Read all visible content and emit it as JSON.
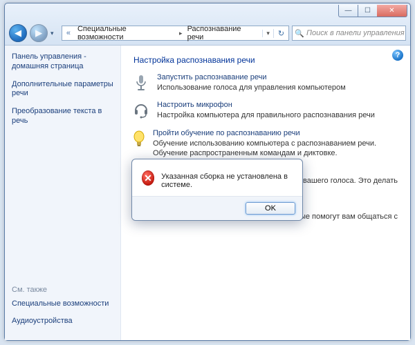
{
  "titlebar": {
    "min": "—",
    "max": "☐",
    "close": "✕"
  },
  "nav": {
    "back": "◀",
    "forward": "▶",
    "drop": "▾",
    "addr_chev": "«",
    "seg1": "Специальные возможности",
    "seg2": "Распознавание речи",
    "sep": "▸",
    "addr_drop": "▾",
    "refresh": "↻"
  },
  "search": {
    "placeholder": "Поиск в панели управления",
    "icon": "🔍"
  },
  "sidebar": {
    "home": "Панель управления - домашняя страница",
    "adv": "Дополнительные параметры речи",
    "tts": "Преобразование текста в речь",
    "see_also": "См. также",
    "acc": "Специальные возможности",
    "audio": "Аудиоустройства"
  },
  "content": {
    "help": "?",
    "title": "Настройка распознавания речи",
    "items": [
      {
        "link": "Запустить распознавание речи",
        "desc": "Использование голоса для управления компьютером"
      },
      {
        "link": "Настроить микрофон",
        "desc": "Настройка компьютера для правильного распознавания речи"
      },
      {
        "link": "Пройти обучение по распознаванию речи",
        "desc": "Обучение использованию компьютера с распознаванием речи. Обучение распространенным командам и диктовке."
      }
    ],
    "partial1": "имание вашего голоса. Это делать",
    "partial2": "торые помогут вам общаться с"
  },
  "dialog": {
    "icon": "✕",
    "message": "Указанная сборка не установлена в системе.",
    "ok": "OK"
  }
}
